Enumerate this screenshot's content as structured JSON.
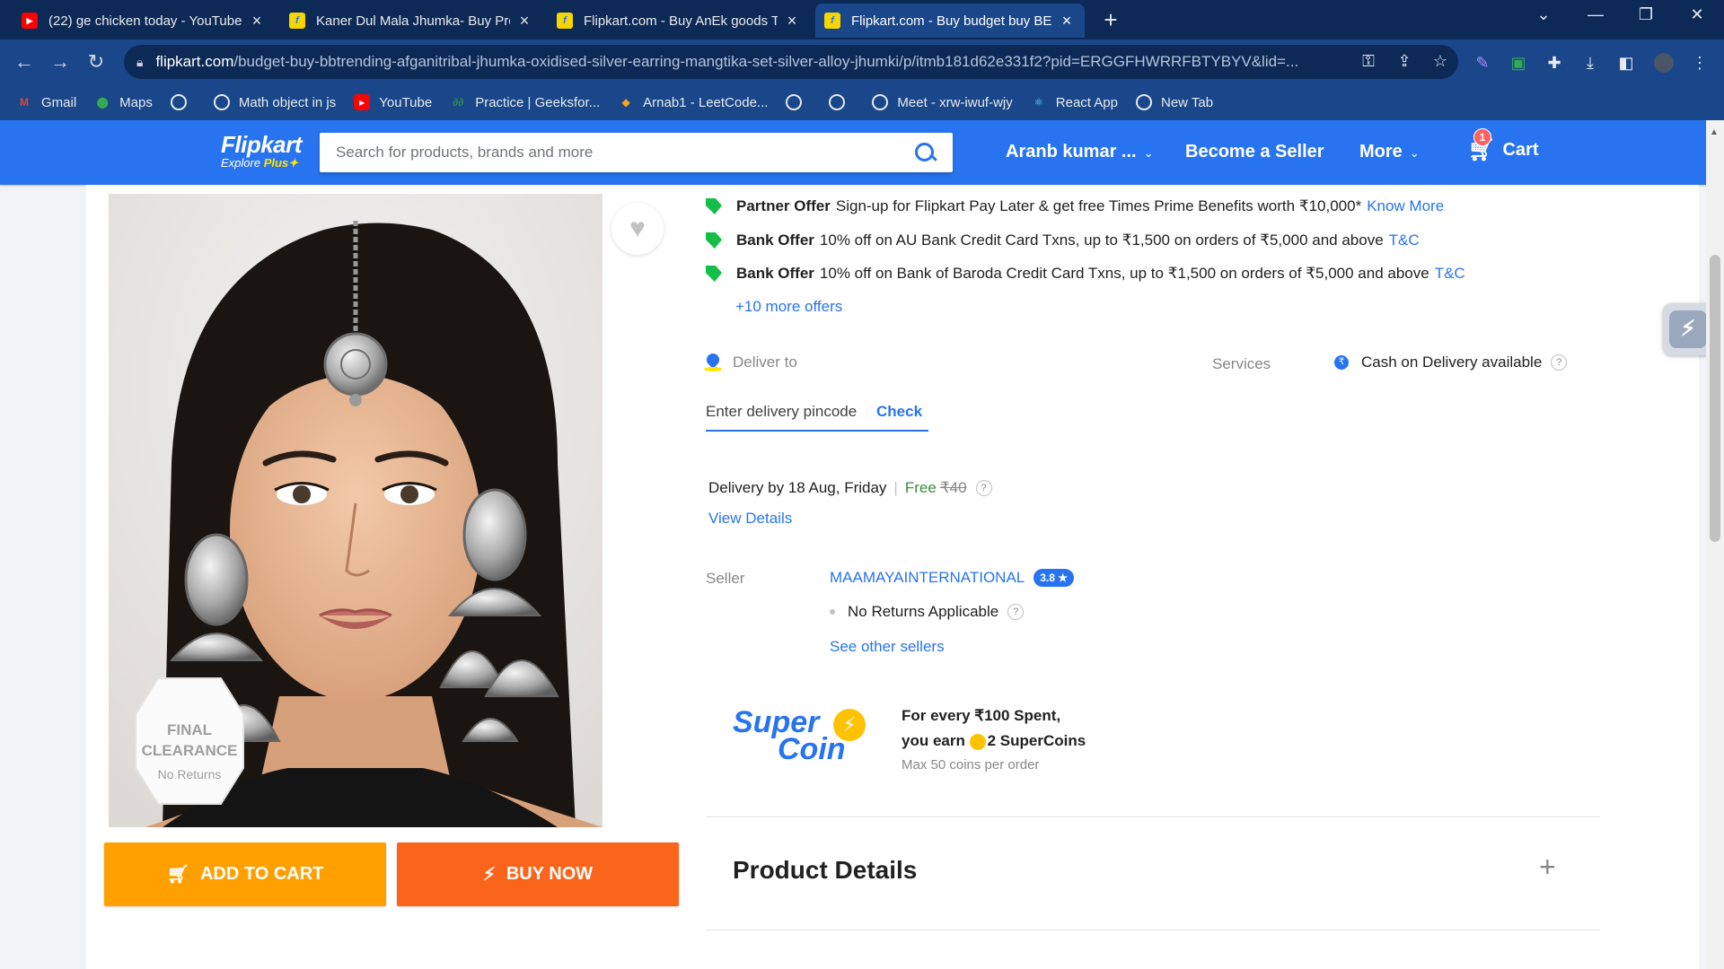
{
  "browser": {
    "tabs": [
      {
        "title": "(22) ge chicken today - YouTube",
        "favicon": "youtube-icon",
        "active": false
      },
      {
        "title": "Kaner Dul Mala Jhumka- Buy Pro",
        "favicon": "flipkart-icon",
        "active": false
      },
      {
        "title": "Flipkart.com - Buy AnEk goods Tr",
        "favicon": "flipkart-icon",
        "active": false
      },
      {
        "title": "Flipkart.com - Buy budget buy BE",
        "favicon": "flipkart-icon",
        "active": true
      }
    ],
    "url_domain": "flipkart.com",
    "url_path": "/budget-buy-bbtrending-afganitribal-jhumka-oxidised-silver-earring-mangtika-set-silver-alloy-jhumki/p/itmb181d62e331f2?pid=ERGGFHWRRFBTYBYV&lid=...",
    "bookmarks": [
      {
        "label": "Gmail",
        "icon": "gmail-icon"
      },
      {
        "label": "Maps",
        "icon": "maps-icon"
      },
      {
        "label": "",
        "icon": "globe-icon"
      },
      {
        "label": "Math object in js",
        "icon": "globe-icon"
      },
      {
        "label": "YouTube",
        "icon": "youtube-icon"
      },
      {
        "label": "Practice | Geeksfor...",
        "icon": "geeksforgeeks-icon"
      },
      {
        "label": "Arnab1 - LeetCode...",
        "icon": "leetcode-icon"
      },
      {
        "label": "",
        "icon": "globe-icon"
      },
      {
        "label": "",
        "icon": "globe-icon"
      },
      {
        "label": "Meet - xrw-iwuf-wjy",
        "icon": "globe-icon"
      },
      {
        "label": "React App",
        "icon": "react-icon"
      },
      {
        "label": "New Tab",
        "icon": "globe-icon"
      }
    ]
  },
  "header": {
    "logo_name": "Flipkart",
    "logo_tagline": "Explore",
    "logo_plus": "Plus",
    "search_placeholder": "Search for products, brands and more",
    "account": "Aranb kumar ...",
    "become_seller": "Become a Seller",
    "more": "More",
    "cart": "Cart",
    "cart_count": "1"
  },
  "product": {
    "image_badge_line1": "FINAL",
    "image_badge_line2": "CLEARANCE",
    "image_badge_line3": "No Returns",
    "add_to_cart": "ADD TO CART",
    "buy_now": "BUY NOW"
  },
  "offers": [
    {
      "type": "Partner Offer",
      "text": "Sign-up for Flipkart Pay Later & get free Times Prime Benefits worth ₹10,000*",
      "link": "Know More"
    },
    {
      "type": "Bank Offer",
      "text": "10% off on AU Bank Credit Card Txns, up to ₹1,500 on orders of ₹5,000 and above",
      "link": "T&C"
    },
    {
      "type": "Bank Offer",
      "text": "10% off on Bank of Baroda Credit Card Txns, up to ₹1,500 on orders of ₹5,000 and above",
      "link": "T&C"
    }
  ],
  "more_offers": "+10 more offers",
  "delivery": {
    "deliver_to": "Deliver to",
    "services_label": "Services",
    "cod": "Cash on Delivery available",
    "pincode_placeholder": "Enter delivery pincode",
    "check": "Check",
    "delivery_date": "Delivery by 18 Aug, Friday",
    "separator": "|",
    "free": "Free",
    "original_charge": "₹40",
    "view_details": "View Details"
  },
  "seller": {
    "label": "Seller",
    "name": "MAAMAYAINTERNATIONAL",
    "rating": "3.8 ★",
    "policy": "No Returns Applicable",
    "other_sellers": "See other sellers"
  },
  "supercoin": {
    "logo_line1": "Super",
    "logo_line2": "Coin",
    "line1": "For every ₹100 Spent,",
    "line2_prefix": "you earn",
    "line2_suffix": "2 SuperCoins",
    "sub": "Max 50 coins per order"
  },
  "product_details": {
    "title": "Product Details",
    "expand": "+"
  },
  "colors": {
    "brand_blue": "#2874f0",
    "add_to_cart": "#ff9f00",
    "buy_now": "#fb641b",
    "offer_tag_green": "#14be47"
  }
}
